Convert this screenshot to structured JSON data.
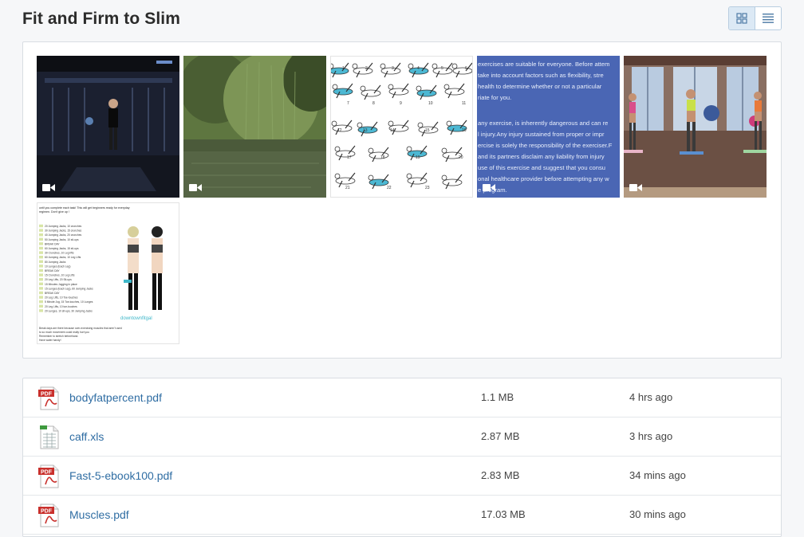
{
  "page": {
    "title": "Fit and Firm to Slim"
  },
  "view_toggle": {
    "grid_icon": "grid-icon",
    "list_icon": "list-icon",
    "active": "grid"
  },
  "gallery": {
    "items": [
      {
        "kind": "video",
        "subject": "man-on-stage"
      },
      {
        "kind": "video",
        "subject": "willow-pond"
      },
      {
        "kind": "image",
        "subject": "yoga-poses-chart",
        "numbers": [
          "1",
          "2",
          "3",
          "4",
          "5",
          "6",
          "7",
          "8",
          "9",
          "10",
          "11",
          "12",
          "13",
          "14",
          "15",
          "16",
          "17",
          "18",
          "19",
          "20",
          "21",
          "22",
          "23"
        ]
      },
      {
        "kind": "video",
        "subject": "disclaimer-text",
        "lines": [
          "exercises are suitable for everyone. Before attem",
          "take into account factors such as flexibility, stre",
          "health to determine whether or not a particular",
          "riate for you.",
          "any exercise, is inherently dangerous and can re",
          "l injury.Any injury sustained from proper or impr",
          "ercise is solely the responsibility of the exerciser.F",
          "and its partners disclaim any liability from injury",
          "use of this exercise and suggest that you consu",
          "onal healthcare provider before attempting any w",
          "e program."
        ]
      },
      {
        "kind": "video",
        "subject": "women-workout-studio"
      },
      {
        "kind": "image",
        "subject": "jumping-jacks-plan",
        "header": "until you complete each task! This will get beginners ready for everyday",
        "header2": "regimen. Don't give up !",
        "lines": [
          "20 Jumping Jacks, 10 crunches",
          "30 Jumping Jacks, 15 crunches",
          "40 Jumping Jacks, 20 crunches",
          "50 Jumping Jacks, 10 sit-ups",
          "BREAK DAY",
          "60 Jumping Jacks, 15 sit-ups",
          "30 Crunches, 10 Leg lifts",
          "60 Jumping Jacks, 10 Leg Lifts",
          "80 Jumping Jacks",
          "10 Lunges (Each Leg)",
          "BREAK DAY",
          "15 Crunches, 10 Leg Lifts",
          "20 Leg Lifts, 20 Sit-ups",
          "15 Minutes Jogging in place",
          "15 Lunges (Each Leg), 60 Jumping Jacks",
          "BREAK DAY",
          "20 Leg Lifts, 10 Toe-touches",
          "5 Minute Jog, 15 Toe-touches, 10 Lunges",
          "20 Leg Lifts, 10 toe-touches",
          "20 Lunges, 10 sit-ups, 30 Jumping Jacks"
        ],
        "brand": "downtownfitgal",
        "footer": [
          "Break days are there because over-exercising muscles that aren't used",
          "to so much movement could really hurt you",
          "Remember to stretch beforehand.",
          "Have water handy!"
        ]
      }
    ],
    "video_icon": "video-camera-icon"
  },
  "files": [
    {
      "name": "bodyfatpercent.pdf",
      "size": "1.1 MB",
      "time": "4 hrs ago",
      "type": "pdf",
      "icon": "pdf-file-icon",
      "badge": "PDF"
    },
    {
      "name": "caff.xls",
      "size": "2.87 MB",
      "time": "3 hrs ago",
      "type": "xls",
      "icon": "spreadsheet-file-icon",
      "badge": ""
    },
    {
      "name": "Fast-5-ebook100.pdf",
      "size": "2.83 MB",
      "time": "34 mins ago",
      "type": "pdf",
      "icon": "pdf-file-icon",
      "badge": "PDF"
    },
    {
      "name": "Muscles.pdf",
      "size": "17.03 MB",
      "time": "30 mins ago",
      "type": "pdf",
      "icon": "pdf-file-icon",
      "badge": "PDF"
    }
  ],
  "colors": {
    "link": "#2f6da3",
    "pdf_red": "#c9302c",
    "xls_green": "#3e9a3e",
    "disclaimer_blue": "#4a66b4"
  }
}
